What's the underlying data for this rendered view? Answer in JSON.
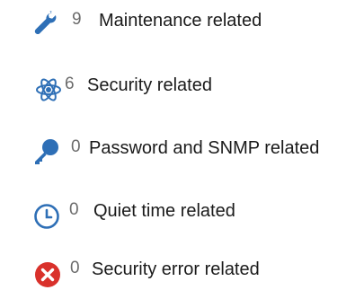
{
  "categories": [
    {
      "icon": "wrench-icon",
      "count": "9",
      "label": "Maintenance related",
      "color": "#2e6fb6"
    },
    {
      "icon": "security-atom-icon",
      "count": "6",
      "label": "Security related",
      "color": "#2e6fb6"
    },
    {
      "icon": "key-icon",
      "count": "0",
      "label": "Password and SNMP related",
      "color": "#2e6fb6"
    },
    {
      "icon": "clock-icon",
      "count": "0",
      "label": "Quiet time related",
      "color": "#2e6fb6"
    },
    {
      "icon": "error-x-icon",
      "count": "0",
      "label": "Security error related",
      "color": "#d9312b"
    }
  ]
}
